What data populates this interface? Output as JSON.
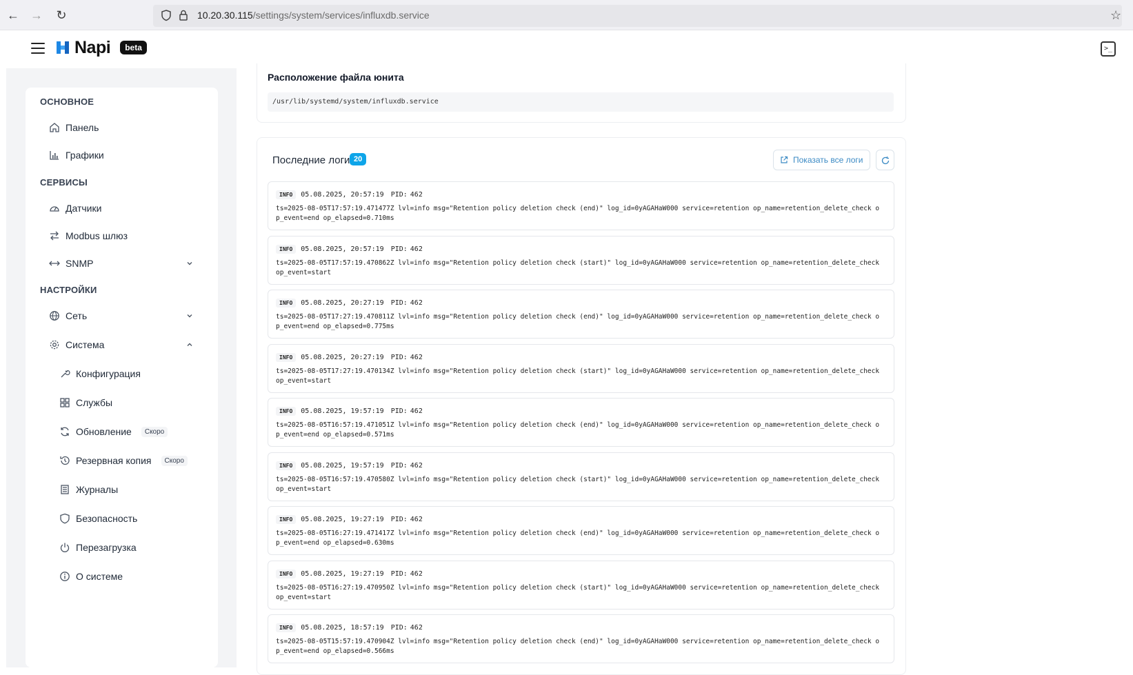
{
  "browser": {
    "url_host": "10.20.30.115",
    "url_path": "/settings/system/services/influxdb.service"
  },
  "header": {
    "logo": "Napi",
    "badge": "beta"
  },
  "sidebar": {
    "sections": [
      {
        "title": "ОСНОВНОЕ"
      },
      {
        "title": "СЕРВИСЫ"
      },
      {
        "title": "НАСТРОЙКИ"
      }
    ],
    "items": [
      {
        "label": "Панель",
        "icon": "home-icon"
      },
      {
        "label": "Графики",
        "icon": "bar-chart-icon"
      },
      {
        "label": "Датчики",
        "icon": "gauge-icon"
      },
      {
        "label": "Modbus шлюз",
        "icon": "swap-icon"
      },
      {
        "label": "SNMP",
        "icon": "arrows-horizontal-icon"
      },
      {
        "label": "Сеть",
        "icon": "globe-icon"
      },
      {
        "label": "Система",
        "icon": "gear-icon"
      },
      {
        "label": "Конфигурация",
        "icon": "wrench-icon"
      },
      {
        "label": "Службы",
        "icon": "grid-icon"
      },
      {
        "label": "Обновление",
        "icon": "sync-icon",
        "badge": "Скоро"
      },
      {
        "label": "Резервная копия",
        "icon": "history-icon",
        "badge": "Скоро"
      },
      {
        "label": "Журналы",
        "icon": "list-icon"
      },
      {
        "label": "Безопасность",
        "icon": "shield-icon"
      },
      {
        "label": "Перезагрузка",
        "icon": "power-icon"
      },
      {
        "label": "О системе",
        "icon": "info-icon"
      }
    ]
  },
  "unit_file": {
    "title": "Расположение файла юнита",
    "path": "/usr/lib/systemd/system/influxdb.service"
  },
  "logs": {
    "title": "Последние логи",
    "count": "20",
    "show_all_label": "Показать все логи",
    "entries": [
      {
        "level": "INFO",
        "time": "05.08.2025, 20:57:19",
        "pid_label": "PID:",
        "pid": "462",
        "message": "ts=2025-08-05T17:57:19.471477Z lvl=info msg=\"Retention policy deletion check (end)\" log_id=0yAGAHaW000 service=retention op_name=retention_delete_check op_event=end op_elapsed=0.710ms"
      },
      {
        "level": "INFO",
        "time": "05.08.2025, 20:57:19",
        "pid_label": "PID:",
        "pid": "462",
        "message": "ts=2025-08-05T17:57:19.470862Z lvl=info msg=\"Retention policy deletion check (start)\" log_id=0yAGAHaW000 service=retention op_name=retention_delete_check op_event=start"
      },
      {
        "level": "INFO",
        "time": "05.08.2025, 20:27:19",
        "pid_label": "PID:",
        "pid": "462",
        "message": "ts=2025-08-05T17:27:19.470811Z lvl=info msg=\"Retention policy deletion check (end)\" log_id=0yAGAHaW000 service=retention op_name=retention_delete_check op_event=end op_elapsed=0.775ms"
      },
      {
        "level": "INFO",
        "time": "05.08.2025, 20:27:19",
        "pid_label": "PID:",
        "pid": "462",
        "message": "ts=2025-08-05T17:27:19.470134Z lvl=info msg=\"Retention policy deletion check (start)\" log_id=0yAGAHaW000 service=retention op_name=retention_delete_check op_event=start"
      },
      {
        "level": "INFO",
        "time": "05.08.2025, 19:57:19",
        "pid_label": "PID:",
        "pid": "462",
        "message": "ts=2025-08-05T16:57:19.471051Z lvl=info msg=\"Retention policy deletion check (end)\" log_id=0yAGAHaW000 service=retention op_name=retention_delete_check op_event=end op_elapsed=0.571ms"
      },
      {
        "level": "INFO",
        "time": "05.08.2025, 19:57:19",
        "pid_label": "PID:",
        "pid": "462",
        "message": "ts=2025-08-05T16:57:19.470580Z lvl=info msg=\"Retention policy deletion check (start)\" log_id=0yAGAHaW000 service=retention op_name=retention_delete_check op_event=start"
      },
      {
        "level": "INFO",
        "time": "05.08.2025, 19:27:19",
        "pid_label": "PID:",
        "pid": "462",
        "message": "ts=2025-08-05T16:27:19.471417Z lvl=info msg=\"Retention policy deletion check (end)\" log_id=0yAGAHaW000 service=retention op_name=retention_delete_check op_event=end op_elapsed=0.630ms"
      },
      {
        "level": "INFO",
        "time": "05.08.2025, 19:27:19",
        "pid_label": "PID:",
        "pid": "462",
        "message": "ts=2025-08-05T16:27:19.470950Z lvl=info msg=\"Retention policy deletion check (start)\" log_id=0yAGAHaW000 service=retention op_name=retention_delete_check op_event=start"
      },
      {
        "level": "INFO",
        "time": "05.08.2025, 18:57:19",
        "pid_label": "PID:",
        "pid": "462",
        "message": "ts=2025-08-05T15:57:19.470904Z lvl=info msg=\"Retention policy deletion check (end)\" log_id=0yAGAHaW000 service=retention op_name=retention_delete_check op_event=end op_elapsed=0.566ms"
      }
    ]
  },
  "colors": {
    "accent": "#0ea5e9",
    "link": "#3b8ac4",
    "sidebar_bg": "#f3f4f6"
  }
}
